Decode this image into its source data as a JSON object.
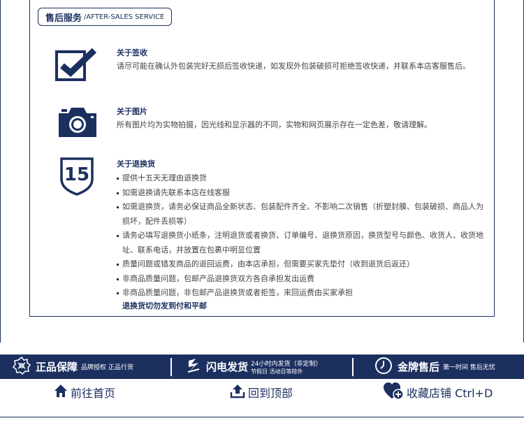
{
  "header": {
    "title_cn": "售后服务",
    "title_en": "/AFTER-SALES SERVICE"
  },
  "sections": {
    "receipt": {
      "icon": "checkbox-icon",
      "title": "关于签收",
      "text": "请尽可能在确认外包装完好无损后签收快递，如发现外包装破损可拒绝签收快递，并联系本店客服售后。"
    },
    "photos": {
      "icon": "camera-icon",
      "title": "关于图片",
      "text": "所有图片均为实物拍摄，因光线和显示器的不同，实物和网页展示存在一定色差，敬请理解。"
    },
    "returns": {
      "icon": "fifteen-days-shield-icon",
      "badge": "15",
      "title": "关于退换货",
      "items": [
        "提供十五天无理由退换货",
        "如需退换请先联系本店在线客服",
        "如需退换货，请务必保证商品全新状态、包装配件齐全、不影响二次销售（折塑封膜、包装破损、商品人为损坏，配件丢损等）",
        "请务必填写退换货小纸条，注明退货或者换货、订单编号、退换货原因，换货型号与颜色、收货人、收货地址、联系电话，并放置在包裹中明显位置",
        "质量问题或错发商品的退回运费，由本店承担，但需要买家先垫付（收到退货后返还）",
        "非商品质量问题，包邮产品退换货双方各自承担发出运费",
        "非商品质量问题，非包邮产品退换货或者拒签，来回运费由买家承担"
      ],
      "note": "退换货切勿发到付和平邮"
    }
  },
  "service_band": {
    "background": "#1c3060",
    "genuine": {
      "icon": "badge-icon",
      "main": "正品保障",
      "sub": "品牌授权 正品行货"
    },
    "shipping": {
      "icon": "lightning-icon",
      "main": "闪电发货",
      "sub1": "24小时内发货（非定制）",
      "sub2": "节假日 活动日等除外"
    },
    "aftersales": {
      "icon": "clock-icon",
      "main": "金牌售后",
      "sub": "第一时间 售后无忧"
    }
  },
  "nav": {
    "home": {
      "icon": "home-icon",
      "label": "前往首页"
    },
    "top": {
      "icon": "upload-icon",
      "label": "回到顶部"
    },
    "favorite": {
      "icon": "heart-plus-icon",
      "label": "收藏店铺 Ctrl+D"
    }
  }
}
